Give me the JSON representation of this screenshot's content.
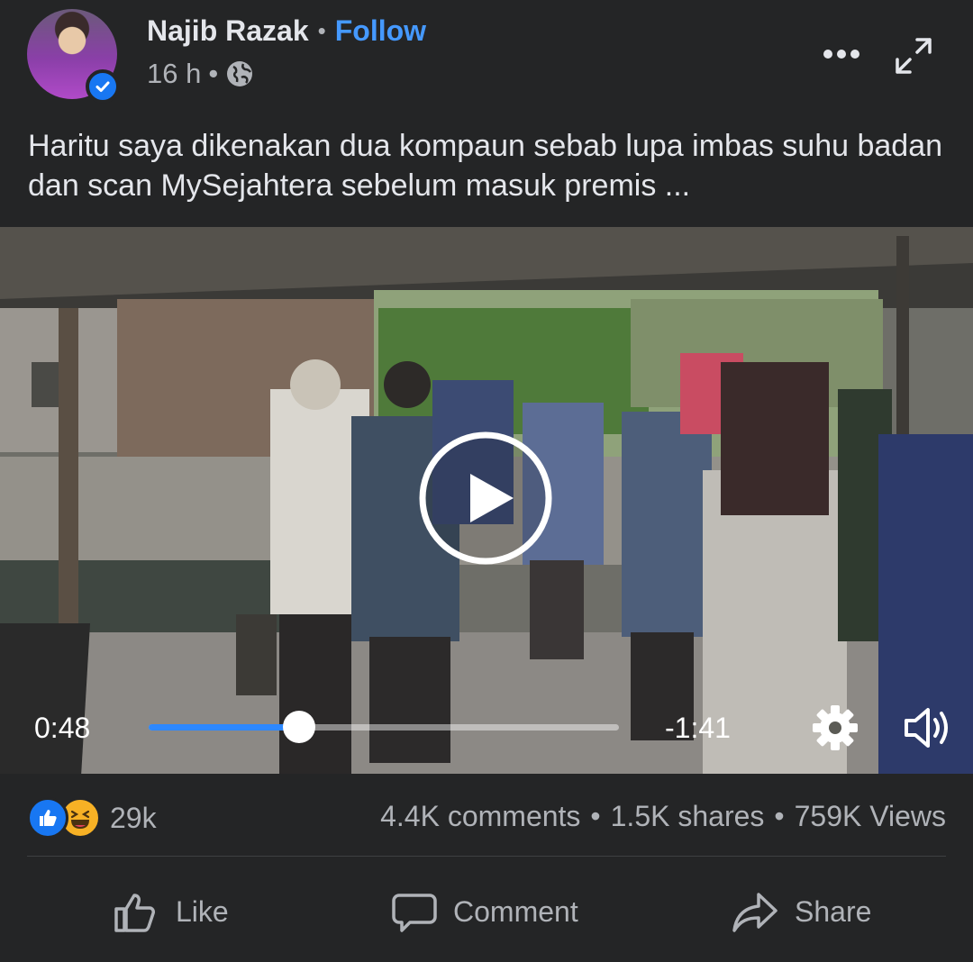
{
  "post": {
    "author": "Najib Razak",
    "follow_label": "Follow",
    "separator": "•",
    "time": "16 h",
    "audience_icon": "globe-icon",
    "caption": "Haritu saya dikenakan dua kompaun sebab lupa imbas suhu badan dan scan MySejahtera sebelum masuk premis ..."
  },
  "video": {
    "current_time": "0:48",
    "remaining_time": "-1:41",
    "progress": 0.32
  },
  "stats": {
    "reaction_count": "29k",
    "comments": "4.4K comments",
    "shares": "1.5K shares",
    "views": "759K Views",
    "separator": "•"
  },
  "actions": {
    "like": "Like",
    "comment": "Comment",
    "share": "Share"
  },
  "colors": {
    "background": "#242526",
    "accent": "#1877f2",
    "follow": "#4599ff",
    "progress": "#2d88ff"
  }
}
